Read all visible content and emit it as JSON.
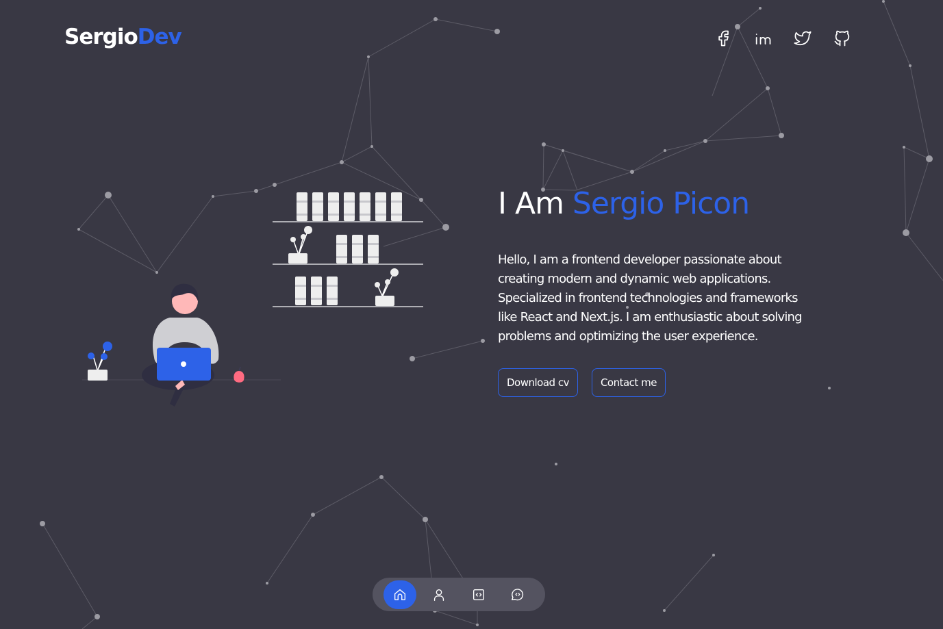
{
  "header": {
    "logo_main": "Sergio",
    "logo_accent": "Dev",
    "socials": [
      {
        "icon": "facebook-icon"
      },
      {
        "icon": "linkedin-icon"
      },
      {
        "icon": "twitter-icon"
      },
      {
        "icon": "github-icon"
      }
    ]
  },
  "hero": {
    "title_prefix": "I Am ",
    "title_name": "Sergio Picon",
    "description": "Hello, I am a frontend developer passionate about creating modern and dynamic web applications. Specialized in frontend technologies and frameworks like React and Next.js. I am enthusiastic about solving problems and optimizing the user experience.",
    "download_button": "Download cv",
    "contact_button": "Contact me"
  },
  "bottom_nav": {
    "items": [
      {
        "icon": "home-icon",
        "active": true
      },
      {
        "icon": "user-icon",
        "active": false
      },
      {
        "icon": "code-icon",
        "active": false
      },
      {
        "icon": "chat-icon",
        "active": false
      }
    ]
  },
  "colors": {
    "background": "#393844",
    "accent": "#2d62e8",
    "text": "#ffffff",
    "nav_background": "#545360",
    "particles": "#9c9ba3"
  }
}
